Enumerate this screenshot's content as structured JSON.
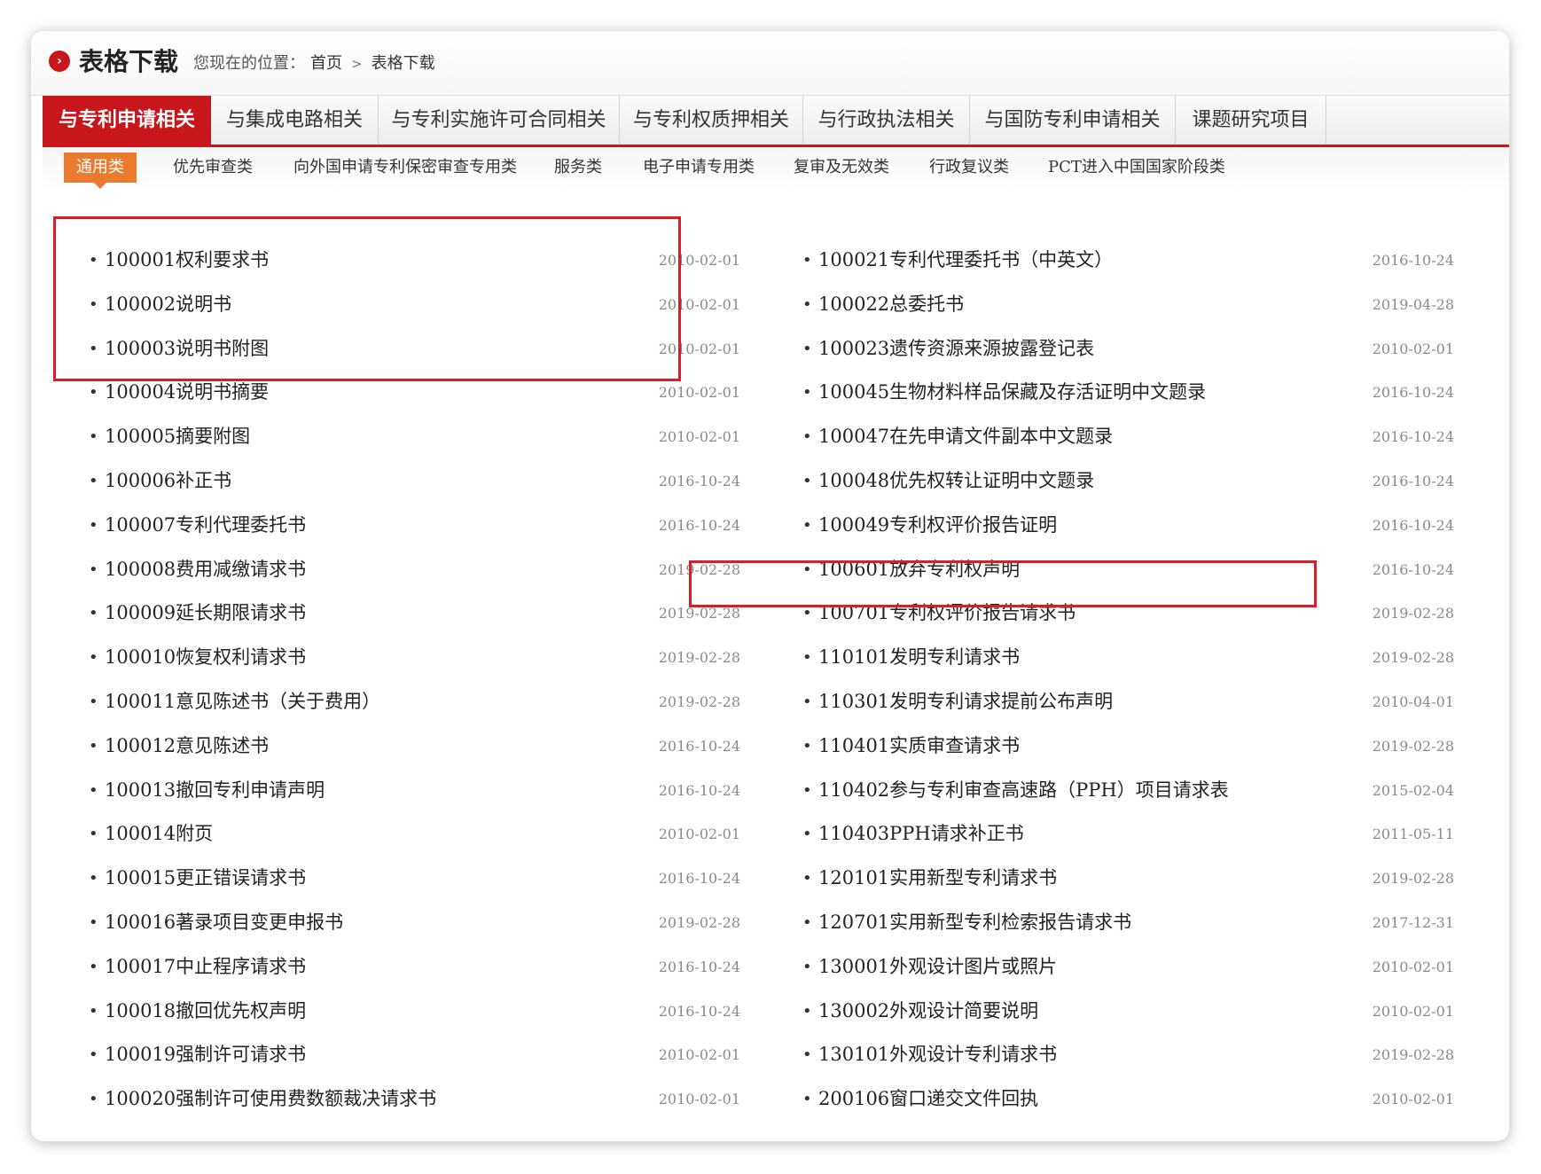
{
  "header": {
    "title_icon": "circle-arrow-icon",
    "title": "表格下载",
    "breadcrumb_label": "您现在的位置：",
    "breadcrumb_home": "首页",
    "breadcrumb_sep": ">",
    "breadcrumb_current": "表格下载"
  },
  "tabs": [
    {
      "label": "与专利申请相关",
      "active": true
    },
    {
      "label": "与集成电路相关"
    },
    {
      "label": "与专利实施许可合同相关"
    },
    {
      "label": "与专利权质押相关"
    },
    {
      "label": "与行政执法相关"
    },
    {
      "label": "与国防专利申请相关"
    },
    {
      "label": "课题研究项目"
    }
  ],
  "subtabs": [
    {
      "label": "通用类",
      "active": true
    },
    {
      "label": "优先审查类"
    },
    {
      "label": "向外国申请专利保密审查专用类"
    },
    {
      "label": "服务类"
    },
    {
      "label": "电子申请专用类"
    },
    {
      "label": "复审及无效类"
    },
    {
      "label": "行政复议类"
    },
    {
      "label": "PCT进入中国国家阶段类"
    }
  ],
  "bullet": "•",
  "left_items": [
    {
      "title": "100001权利要求书",
      "date": "2010-02-01"
    },
    {
      "title": "100002说明书",
      "date": "2010-02-01"
    },
    {
      "title": "100003说明书附图",
      "date": "2010-02-01"
    },
    {
      "title": "100004说明书摘要",
      "date": "2010-02-01"
    },
    {
      "title": "100005摘要附图",
      "date": "2010-02-01"
    },
    {
      "title": "100006补正书",
      "date": "2016-10-24"
    },
    {
      "title": "100007专利代理委托书",
      "date": "2016-10-24"
    },
    {
      "title": "100008费用减缴请求书",
      "date": "2019-02-28"
    },
    {
      "title": "100009延长期限请求书",
      "date": "2019-02-28"
    },
    {
      "title": "100010恢复权利请求书",
      "date": "2019-02-28"
    },
    {
      "title": "100011意见陈述书（关于费用）",
      "date": "2019-02-28"
    },
    {
      "title": "100012意见陈述书",
      "date": "2016-10-24"
    },
    {
      "title": "100013撤回专利申请声明",
      "date": "2016-10-24"
    },
    {
      "title": "100014附页",
      "date": "2010-02-01"
    },
    {
      "title": "100015更正错误请求书",
      "date": "2016-10-24"
    },
    {
      "title": "100016著录项目变更申报书",
      "date": "2019-02-28"
    },
    {
      "title": "100017中止程序请求书",
      "date": "2016-10-24"
    },
    {
      "title": "100018撤回优先权声明",
      "date": "2016-10-24"
    },
    {
      "title": "100019强制许可请求书",
      "date": "2010-02-01"
    },
    {
      "title": "100020强制许可使用费数额裁决请求书",
      "date": "2010-02-01"
    }
  ],
  "right_items": [
    {
      "title": "100021专利代理委托书（中英文）",
      "date": "2016-10-24"
    },
    {
      "title": "100022总委托书",
      "date": "2019-04-28"
    },
    {
      "title": "100023遗传资源来源披露登记表",
      "date": "2010-02-01"
    },
    {
      "title": "100045生物材料样品保藏及存活证明中文题录",
      "date": "2016-10-24"
    },
    {
      "title": "100047在先申请文件副本中文题录",
      "date": "2016-10-24"
    },
    {
      "title": "100048优先权转让证明中文题录",
      "date": "2016-10-24"
    },
    {
      "title": "100049专利权评价报告证明",
      "date": "2016-10-24"
    },
    {
      "title": "100601放弃专利权声明",
      "date": "2016-10-24"
    },
    {
      "title": "100701专利权评价报告请求书",
      "date": "2019-02-28"
    },
    {
      "title": "110101发明专利请求书",
      "date": "2019-02-28"
    },
    {
      "title": "110301发明专利请求提前公布声明",
      "date": "2010-04-01"
    },
    {
      "title": "110401实质审查请求书",
      "date": "2019-02-28"
    },
    {
      "title": "110402参与专利审查高速路（PPH）项目请求表",
      "date": "2015-02-04"
    },
    {
      "title": "110403PPH请求补正书",
      "date": "2011-05-11"
    },
    {
      "title": "120101实用新型专利请求书",
      "date": "2019-02-28"
    },
    {
      "title": "120701实用新型专利检索报告请求书",
      "date": "2017-12-31"
    },
    {
      "title": "130001外观设计图片或照片",
      "date": "2010-02-01"
    },
    {
      "title": "130002外观设计简要说明",
      "date": "2010-02-01"
    },
    {
      "title": "130101外观设计专利请求书",
      "date": "2019-02-28"
    },
    {
      "title": "200106窗口递交文件回执",
      "date": "2010-02-01"
    }
  ],
  "colors": {
    "accent_red": "#c8161d",
    "subtab_orange": "#e97a2e",
    "highlight_box": "#d81e28"
  }
}
